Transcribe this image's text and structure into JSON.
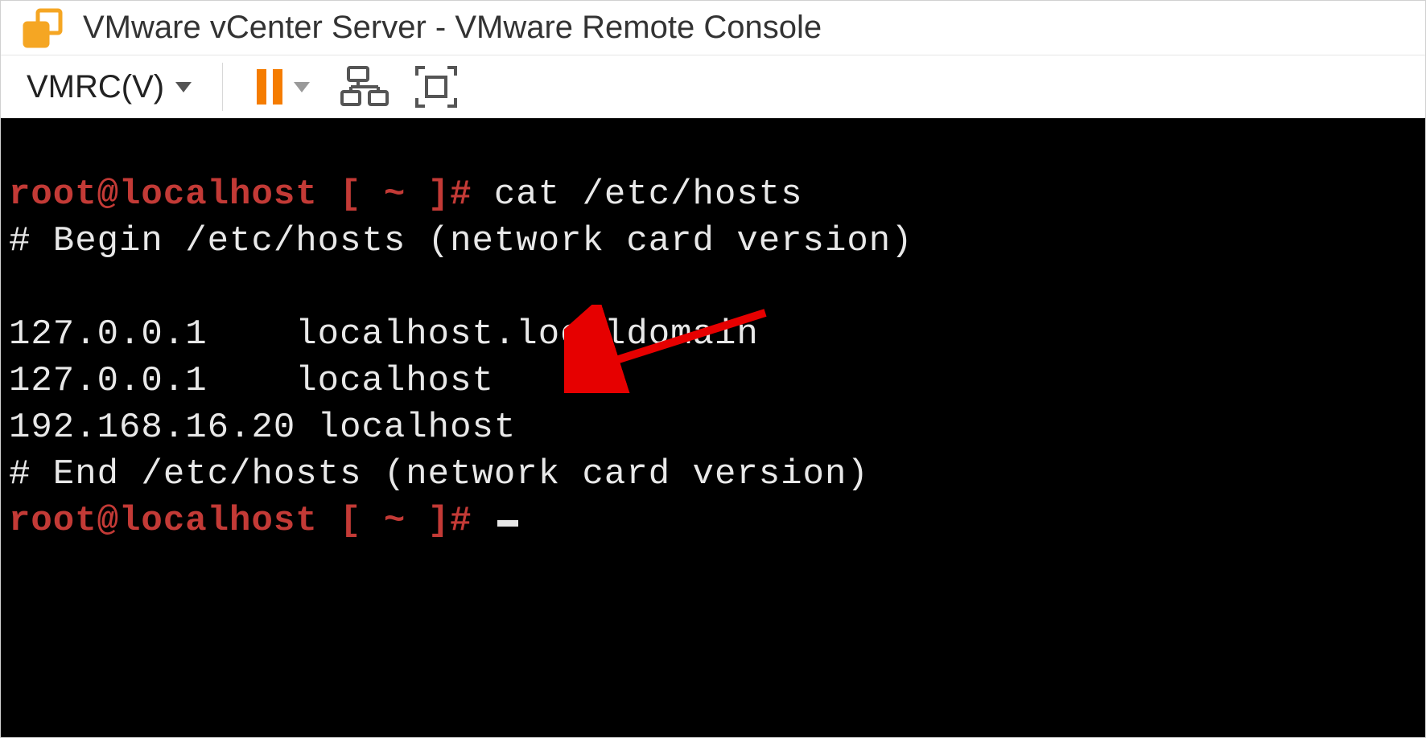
{
  "window": {
    "title": "VMware vCenter Server - VMware Remote Console"
  },
  "toolbar": {
    "menu_label": "VMRC(V)"
  },
  "terminal": {
    "prompt1_user": "root@localhost",
    "prompt1_bracket": " [ ~ ]# ",
    "cmd1": "cat /etc/hosts",
    "line1": "# Begin /etc/hosts (network card version)",
    "blank": "",
    "line2": "127.0.0.1    localhost.localdomain",
    "line3": "127.0.0.1    localhost",
    "line4": "192.168.16.20 localhost",
    "line5": "# End /etc/hosts (network card version)",
    "prompt2_user": "root@localhost",
    "prompt2_bracket": " [ ~ ]# "
  },
  "colors": {
    "accent_orange": "#f57c00",
    "prompt_red": "#c33a36",
    "arrow_red": "#e60000"
  }
}
